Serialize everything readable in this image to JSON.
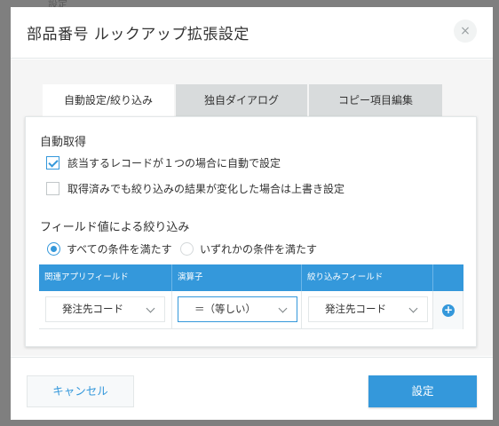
{
  "backdrop": {
    "text": "設定"
  },
  "dialog": {
    "title": "部品番号 ルックアップ拡張設定",
    "close_symbol": "×"
  },
  "tabs": [
    {
      "label": "自動設定/絞り込み",
      "active": true
    },
    {
      "label": "独自ダイアログ",
      "active": false
    },
    {
      "label": "コピー項目編集",
      "active": false
    }
  ],
  "auto_fetch": {
    "title": "自動取得",
    "options": [
      {
        "label": "該当するレコードが１つの場合に自動で設定",
        "checked": true
      },
      {
        "label": "取得済みでも絞り込みの結果が変化した場合は上書き設定",
        "checked": false
      }
    ]
  },
  "filter": {
    "title": "フィールド値による絞り込み",
    "match_options": [
      {
        "label": "すべての条件を満たす",
        "selected": true
      },
      {
        "label": "いずれかの条件を満たす",
        "selected": false
      }
    ],
    "columns": [
      "関連アプリフィールド",
      "演算子",
      "絞り込みフィールド"
    ],
    "rows": [
      {
        "related_field": "発注先コード",
        "operator": "＝（等しい）",
        "filter_field": "発注先コード"
      }
    ],
    "add_symbol": "+"
  },
  "footer": {
    "cancel_label": "キャンセル",
    "ok_label": "設定"
  },
  "colors": {
    "accent": "#3498db",
    "panel_bg": "#f5f5f5",
    "tab_inactive": "#d8dbdc"
  }
}
